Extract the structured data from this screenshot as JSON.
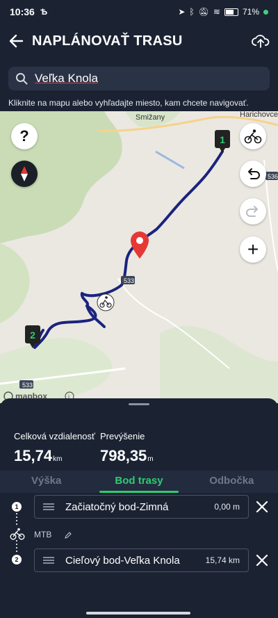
{
  "status": {
    "time": "10:36",
    "battery": "71%"
  },
  "header": {
    "title": "NAPLÁNOVAŤ TRASU"
  },
  "search": {
    "value": "Veľka Knola"
  },
  "hint": "Kliknite na mapu alebo vyhľadajte miesto, kam chcete navigovať.",
  "map": {
    "places": [
      "Smižany",
      "Harichovce"
    ],
    "road_labels": [
      "533",
      "533",
      "536"
    ],
    "markers": {
      "start": "1",
      "end": "2"
    },
    "attribution": "mapbox",
    "route_color": "#1a237e"
  },
  "controls": {
    "help": "?",
    "add": "+"
  },
  "stats": {
    "distance_label": "Celková vzdialenosť",
    "distance_value": "15,74",
    "distance_unit": "km",
    "elevation_label": "Prevýšenie",
    "elevation_value": "798,35",
    "elevation_unit": "m"
  },
  "tabs": [
    "Výška",
    "Bod trasy",
    "Odbočka"
  ],
  "active_tab": "Bod trasy",
  "waypoints": [
    {
      "index": "1",
      "name": "Začiatočný bod-Zimná",
      "distance": "0,00 m"
    },
    {
      "index": "2",
      "name": "Cieľový bod-Veľka Knola",
      "distance": "15,74 km"
    }
  ],
  "mode": "MTB",
  "colors": {
    "bg": "#1b2333",
    "accent": "#2ecc71",
    "pin": "#e53935"
  }
}
